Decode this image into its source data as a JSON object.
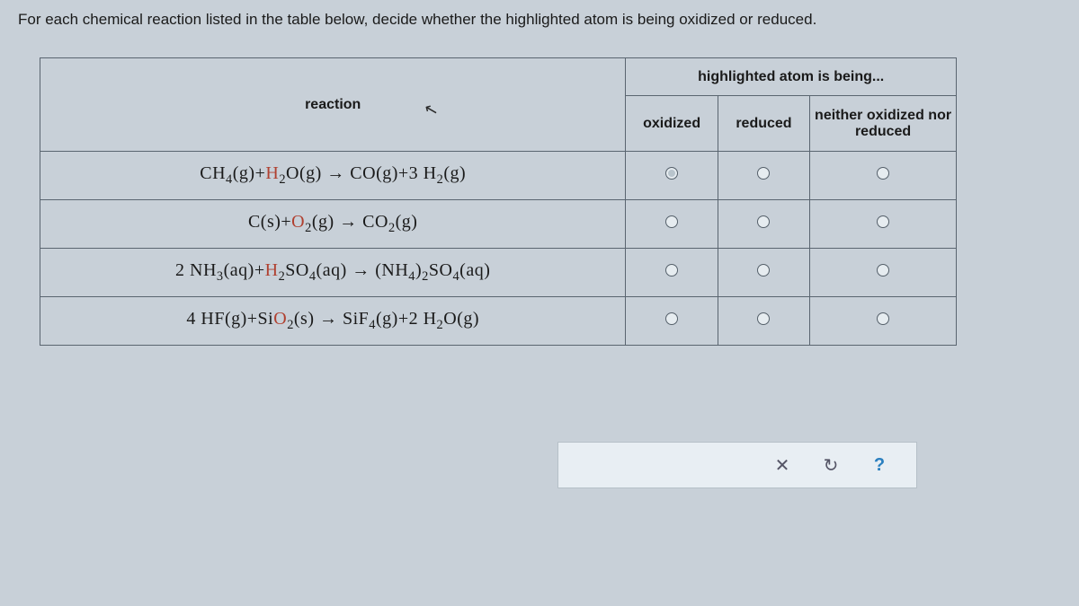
{
  "prompt": "For each chemical reaction listed in the table below, decide whether the highlighted atom is being oxidized or reduced.",
  "headers": {
    "reaction": "reaction",
    "group": "highlighted atom is being...",
    "oxidized": "oxidized",
    "reduced": "reduced",
    "neither": "neither oxidized nor reduced"
  },
  "rows": [
    {
      "eq_html": "CH<sub>4</sub>(g)+<span class='hl'>H</span><sub>2</sub>O(g) → CO(g)+3 H<sub>2</sub>(g)"
    },
    {
      "eq_html": "C(s)+<span class='hl'>O</span><sub>2</sub>(g) → CO<sub>2</sub>(g)"
    },
    {
      "eq_html": "2 NH<sub>3</sub>(aq)+<span class='hl'>H</span><sub>2</sub>SO<sub>4</sub>(aq) → (NH<sub>4</sub>)<sub>2</sub>SO<sub>4</sub>(aq)"
    },
    {
      "eq_html": "4 HF(g)+Si<span class='hl'>O</span><sub>2</sub>(s) → SiF<sub>4</sub>(g)+2 H<sub>2</sub>O(g)"
    }
  ],
  "footer": {
    "close": "✕",
    "reset": "↻",
    "help": "?"
  }
}
